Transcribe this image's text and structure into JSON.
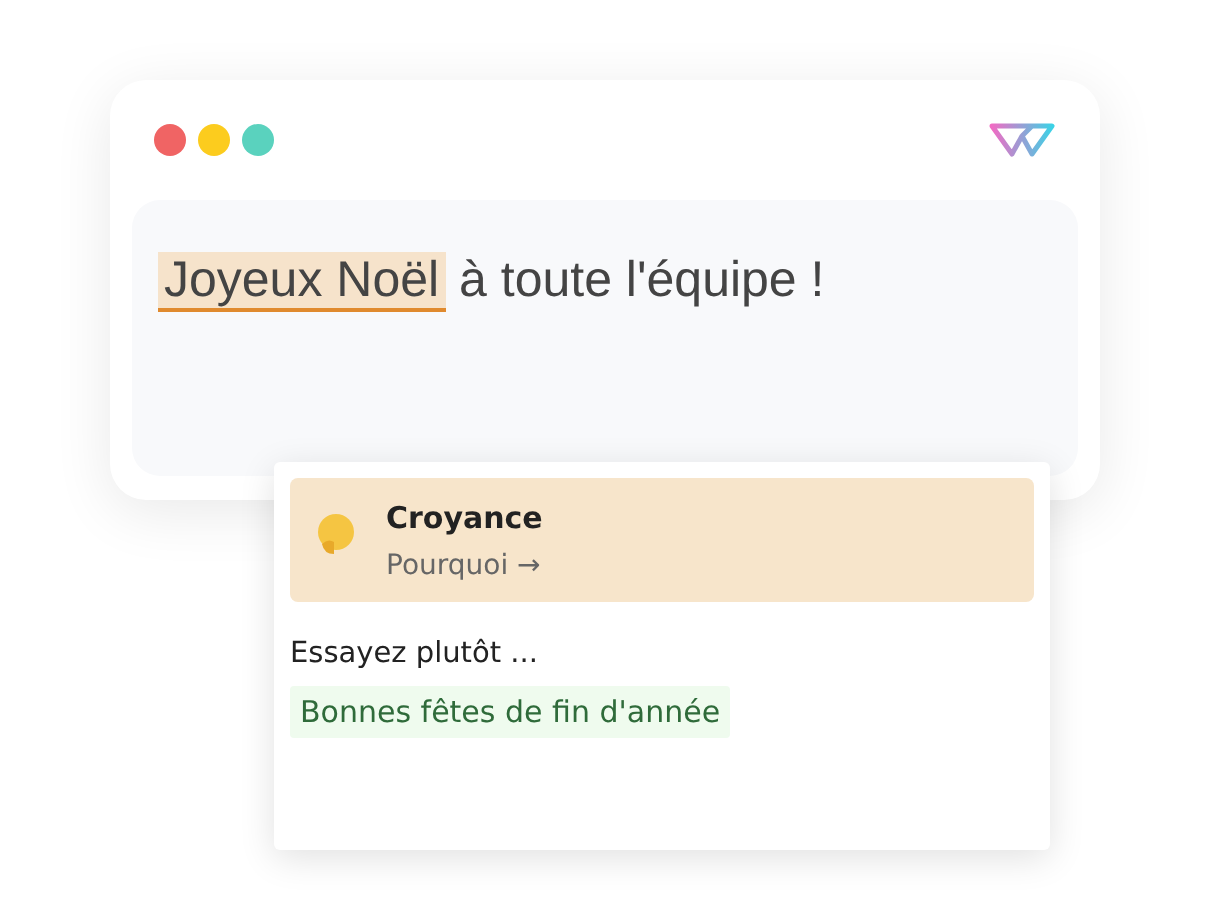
{
  "window": {
    "controls": [
      {
        "color": "#f06464"
      },
      {
        "color": "#fccc1e"
      },
      {
        "color": "#5ad2be"
      }
    ]
  },
  "editor": {
    "segments": [
      {
        "text": "Joyeux Noël",
        "flagged": true
      },
      {
        "text": "à toute l'équipe !",
        "flagged": false
      }
    ]
  },
  "suggestion": {
    "category": "Croyance",
    "link": "Pourquoi →",
    "prompt": "Essayez plutôt ...",
    "alternatives": [
      "Bonnes fêtes de fin d'année"
    ]
  }
}
